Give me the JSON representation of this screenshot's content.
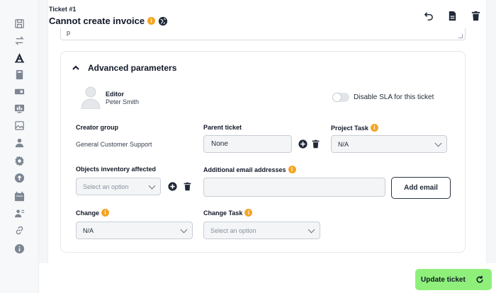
{
  "header": {
    "ticket_number": "Ticket #1",
    "title": "Cannot create invoice",
    "info_icon_glyph": "i",
    "info_color": "#f5a524"
  },
  "description": {
    "value": "p"
  },
  "advanced": {
    "title": "Advanced parameters",
    "editor": {
      "role": "Editor",
      "name": "Peter Smith"
    },
    "sla_toggle": {
      "label": "Disable SLA for this ticket",
      "enabled": false
    },
    "creator_group": {
      "label": "Creator group",
      "value": "General Customer Support"
    },
    "parent_ticket": {
      "label": "Parent ticket",
      "value": "None"
    },
    "project_task": {
      "label": "Project Task",
      "value": "N/A"
    },
    "objects_inventory": {
      "label": "Objects inventory affected",
      "placeholder": "Select an option"
    },
    "additional_emails": {
      "label": "Additional email addresses",
      "value": "",
      "add_button": "Add email"
    },
    "change": {
      "label": "Change",
      "value": "N/A"
    },
    "change_task": {
      "label": "Change Task",
      "placeholder": "Select an option"
    }
  },
  "footer": {
    "update_button": "Update ticket",
    "accent_color": "#8ef07a"
  },
  "sidebar": {
    "icons": [
      "save-icon",
      "switch-icon",
      "ticket-icon",
      "calculator-icon",
      "badge-icon",
      "chart-icon",
      "image-icon",
      "user-icon",
      "settings-icon",
      "upload-icon",
      "calendar-icon",
      "user-group-icon",
      "link-icon",
      "info-icon"
    ]
  }
}
